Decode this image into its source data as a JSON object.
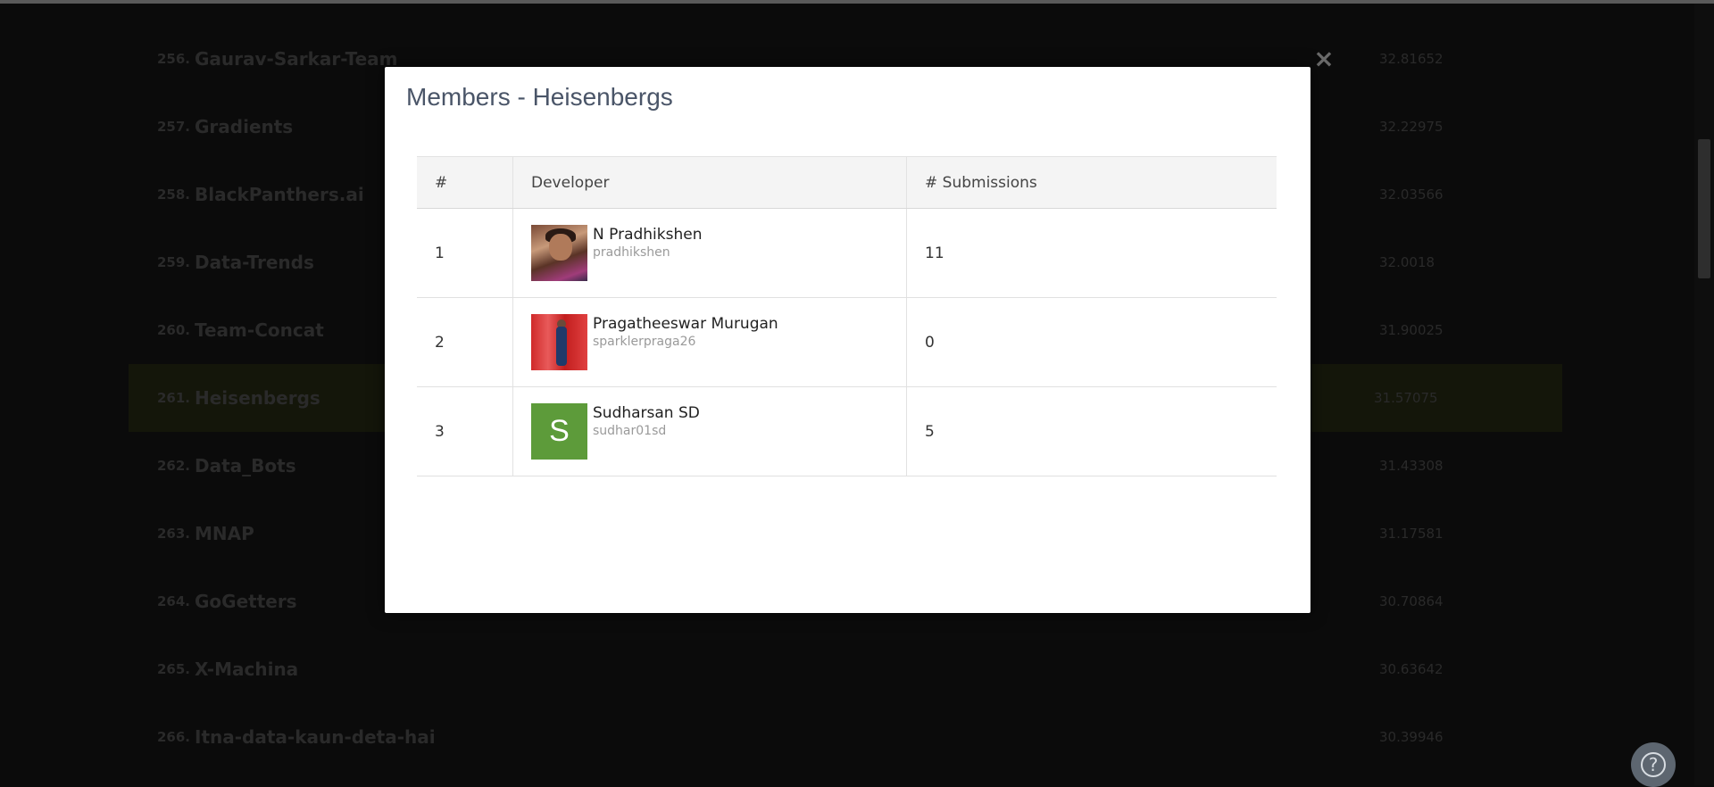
{
  "leaderboard": {
    "rows": [
      {
        "rank": "256.",
        "name": "Gaurav-Sarkar-Team",
        "score": "32.81652",
        "highlight": false
      },
      {
        "rank": "257.",
        "name": "Gradients",
        "score": "32.22975",
        "highlight": false
      },
      {
        "rank": "258.",
        "name": "BlackPanthers.ai",
        "score": "32.03566",
        "highlight": false
      },
      {
        "rank": "259.",
        "name": "Data-Trends",
        "score": "32.0018",
        "highlight": false
      },
      {
        "rank": "260.",
        "name": "Team-Concat",
        "score": "31.90025",
        "highlight": false
      },
      {
        "rank": "261.",
        "name": "Heisenbergs",
        "score": "31.57075",
        "highlight": true
      },
      {
        "rank": "262.",
        "name": "Data_Bots",
        "score": "31.43308",
        "highlight": false
      },
      {
        "rank": "263.",
        "name": "MNAP",
        "score": "31.17581",
        "highlight": false
      },
      {
        "rank": "264.",
        "name": "GoGetters",
        "score": "30.70864",
        "highlight": false
      },
      {
        "rank": "265.",
        "name": "X-Machina",
        "score": "30.63642",
        "highlight": false
      },
      {
        "rank": "266.",
        "name": "Itna-data-kaun-deta-hai",
        "score": "30.39946",
        "highlight": false
      }
    ]
  },
  "modal": {
    "title": "Members - Heisenbergs",
    "close_glyph": "×",
    "columns": [
      "#",
      "Developer",
      "# Submissions"
    ],
    "members": [
      {
        "rank": "1",
        "name": "N Pradhikshen",
        "handle": "pradhikshen",
        "submissions": "11",
        "avatar": "photo"
      },
      {
        "rank": "2",
        "name": "Pragatheeswar Murugan",
        "handle": "sparklerpraga26",
        "submissions": "0",
        "avatar": "photo"
      },
      {
        "rank": "3",
        "name": "Sudharsan SD",
        "handle": "sudhar01sd",
        "submissions": "5",
        "avatar": "letter",
        "avatar_letter": "S"
      }
    ]
  },
  "help": {
    "glyph": "?"
  },
  "colors": {
    "overlay_bg": "#0b0b0b",
    "highlight_row": "#14160a",
    "letter_avatar": "#5d9b3a",
    "title_text": "#4a5568"
  }
}
